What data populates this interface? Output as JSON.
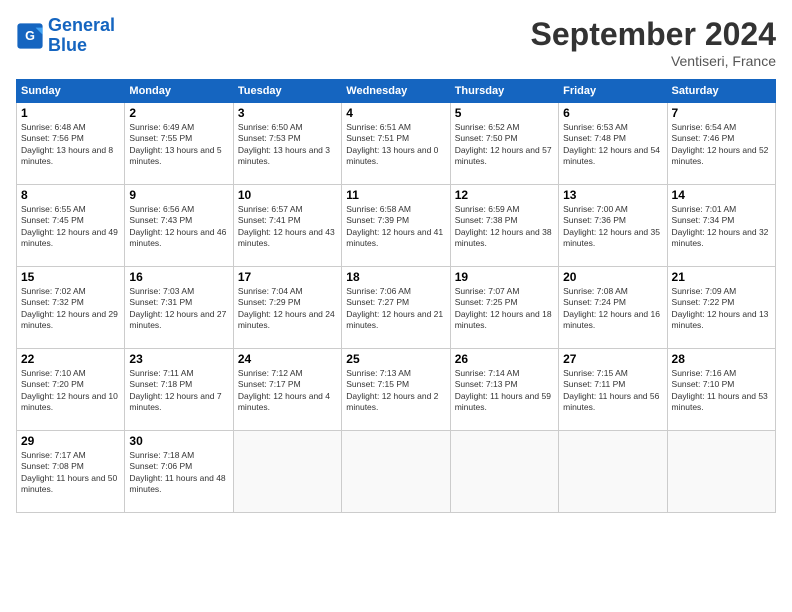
{
  "logo": {
    "line1": "General",
    "line2": "Blue"
  },
  "header": {
    "month_year": "September 2024",
    "location": "Ventiseri, France"
  },
  "weekdays": [
    "Sunday",
    "Monday",
    "Tuesday",
    "Wednesday",
    "Thursday",
    "Friday",
    "Saturday"
  ],
  "weeks": [
    [
      {
        "day": "1",
        "sunrise": "6:48 AM",
        "sunset": "7:56 PM",
        "daylight": "13 hours and 8 minutes."
      },
      {
        "day": "2",
        "sunrise": "6:49 AM",
        "sunset": "7:55 PM",
        "daylight": "13 hours and 5 minutes."
      },
      {
        "day": "3",
        "sunrise": "6:50 AM",
        "sunset": "7:53 PM",
        "daylight": "13 hours and 3 minutes."
      },
      {
        "day": "4",
        "sunrise": "6:51 AM",
        "sunset": "7:51 PM",
        "daylight": "13 hours and 0 minutes."
      },
      {
        "day": "5",
        "sunrise": "6:52 AM",
        "sunset": "7:50 PM",
        "daylight": "12 hours and 57 minutes."
      },
      {
        "day": "6",
        "sunrise": "6:53 AM",
        "sunset": "7:48 PM",
        "daylight": "12 hours and 54 minutes."
      },
      {
        "day": "7",
        "sunrise": "6:54 AM",
        "sunset": "7:46 PM",
        "daylight": "12 hours and 52 minutes."
      }
    ],
    [
      {
        "day": "8",
        "sunrise": "6:55 AM",
        "sunset": "7:45 PM",
        "daylight": "12 hours and 49 minutes."
      },
      {
        "day": "9",
        "sunrise": "6:56 AM",
        "sunset": "7:43 PM",
        "daylight": "12 hours and 46 minutes."
      },
      {
        "day": "10",
        "sunrise": "6:57 AM",
        "sunset": "7:41 PM",
        "daylight": "12 hours and 43 minutes."
      },
      {
        "day": "11",
        "sunrise": "6:58 AM",
        "sunset": "7:39 PM",
        "daylight": "12 hours and 41 minutes."
      },
      {
        "day": "12",
        "sunrise": "6:59 AM",
        "sunset": "7:38 PM",
        "daylight": "12 hours and 38 minutes."
      },
      {
        "day": "13",
        "sunrise": "7:00 AM",
        "sunset": "7:36 PM",
        "daylight": "12 hours and 35 minutes."
      },
      {
        "day": "14",
        "sunrise": "7:01 AM",
        "sunset": "7:34 PM",
        "daylight": "12 hours and 32 minutes."
      }
    ],
    [
      {
        "day": "15",
        "sunrise": "7:02 AM",
        "sunset": "7:32 PM",
        "daylight": "12 hours and 29 minutes."
      },
      {
        "day": "16",
        "sunrise": "7:03 AM",
        "sunset": "7:31 PM",
        "daylight": "12 hours and 27 minutes."
      },
      {
        "day": "17",
        "sunrise": "7:04 AM",
        "sunset": "7:29 PM",
        "daylight": "12 hours and 24 minutes."
      },
      {
        "day": "18",
        "sunrise": "7:06 AM",
        "sunset": "7:27 PM",
        "daylight": "12 hours and 21 minutes."
      },
      {
        "day": "19",
        "sunrise": "7:07 AM",
        "sunset": "7:25 PM",
        "daylight": "12 hours and 18 minutes."
      },
      {
        "day": "20",
        "sunrise": "7:08 AM",
        "sunset": "7:24 PM",
        "daylight": "12 hours and 16 minutes."
      },
      {
        "day": "21",
        "sunrise": "7:09 AM",
        "sunset": "7:22 PM",
        "daylight": "12 hours and 13 minutes."
      }
    ],
    [
      {
        "day": "22",
        "sunrise": "7:10 AM",
        "sunset": "7:20 PM",
        "daylight": "12 hours and 10 minutes."
      },
      {
        "day": "23",
        "sunrise": "7:11 AM",
        "sunset": "7:18 PM",
        "daylight": "12 hours and 7 minutes."
      },
      {
        "day": "24",
        "sunrise": "7:12 AM",
        "sunset": "7:17 PM",
        "daylight": "12 hours and 4 minutes."
      },
      {
        "day": "25",
        "sunrise": "7:13 AM",
        "sunset": "7:15 PM",
        "daylight": "12 hours and 2 minutes."
      },
      {
        "day": "26",
        "sunrise": "7:14 AM",
        "sunset": "7:13 PM",
        "daylight": "11 hours and 59 minutes."
      },
      {
        "day": "27",
        "sunrise": "7:15 AM",
        "sunset": "7:11 PM",
        "daylight": "11 hours and 56 minutes."
      },
      {
        "day": "28",
        "sunrise": "7:16 AM",
        "sunset": "7:10 PM",
        "daylight": "11 hours and 53 minutes."
      }
    ],
    [
      {
        "day": "29",
        "sunrise": "7:17 AM",
        "sunset": "7:08 PM",
        "daylight": "11 hours and 50 minutes."
      },
      {
        "day": "30",
        "sunrise": "7:18 AM",
        "sunset": "7:06 PM",
        "daylight": "11 hours and 48 minutes."
      },
      null,
      null,
      null,
      null,
      null
    ]
  ]
}
